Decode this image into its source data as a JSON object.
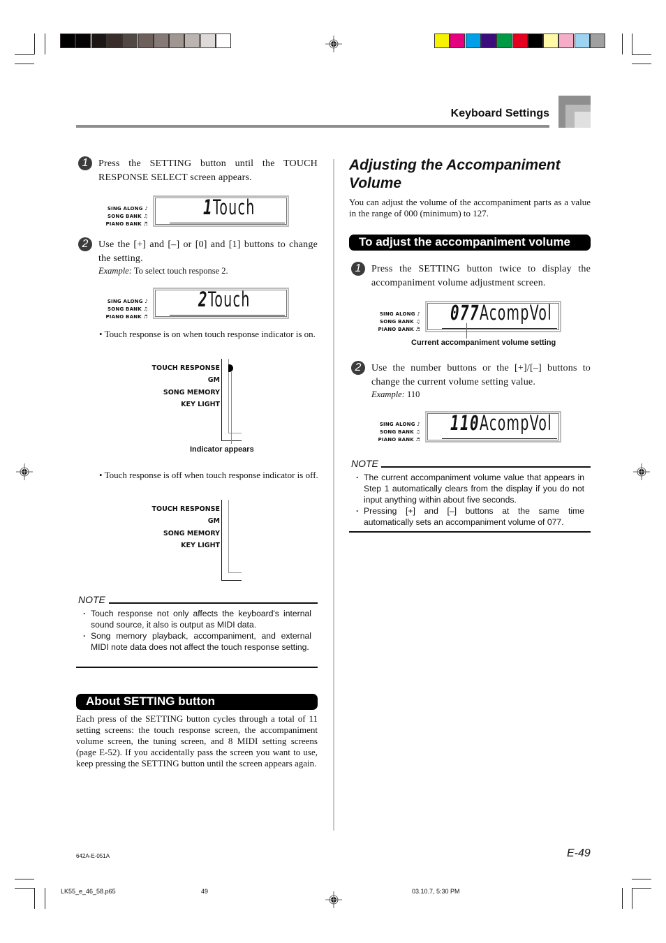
{
  "print_marks": {
    "grayscale_swatches": [
      "#000000",
      "#050303",
      "#1c1714",
      "#382d29",
      "#524843",
      "#6d605b",
      "#857a75",
      "#a19792",
      "#bcb4b0",
      "#dedad8",
      "#ffffff"
    ],
    "color_swatches": [
      "#f7f200",
      "#e4007f",
      "#00a0e9",
      "#3c0b7c",
      "#009944",
      "#e30020",
      "#000000",
      "#fff9a8",
      "#f6aec8",
      "#9cd4f2",
      "#a0a0a0"
    ]
  },
  "header": {
    "title": "Keyboard Settings"
  },
  "left": {
    "step1": {
      "number": "1",
      "text": "Press the SETTING button until the TOUCH RESPONSE SELECT screen appears.",
      "display": {
        "labels": [
          "SING ALONG",
          "SONG BANK",
          "PIANO BANK"
        ],
        "number": "1",
        "text": "Touch"
      }
    },
    "step2": {
      "number": "2",
      "text": "Use the [+] and [–] or [0] and [1] buttons to change the setting.",
      "example_label": "Example:",
      "example_text": "To select touch response 2.",
      "display": {
        "labels": [
          "SING ALONG",
          "SONG BANK",
          "PIANO BANK"
        ],
        "number": "2",
        "text": "Touch"
      }
    },
    "bullet_on": "• Touch response is on when touch response indicator is on.",
    "indicator_on": {
      "labels": [
        "TOUCH RESPONSE",
        "GM",
        "SONG MEMORY",
        "KEY LIGHT"
      ],
      "caption": "Indicator appears"
    },
    "bullet_off": "• Touch response is off when touch response indicator is off.",
    "indicator_off": {
      "labels": [
        "TOUCH RESPONSE",
        "GM",
        "SONG MEMORY",
        "KEY LIGHT"
      ]
    },
    "note": {
      "heading": "NOTE",
      "items": [
        "Touch response not only affects the keyboard's internal sound source, it also is output as MIDI data.",
        "Song memory playback, accompaniment, and external MIDI note data does not affect the touch response setting."
      ]
    },
    "about": {
      "heading": "About SETTING button",
      "text": "Each press of the SETTING button cycles through a total of 11 setting screens: the touch response screen, the accompaniment volume screen, the tuning screen, and 8 MIDI setting screens (page E-52). If you accidentally pass the screen you want to use, keep pressing the SETTING button until the screen appears again."
    }
  },
  "right": {
    "title": "Adjusting the Accompaniment Volume",
    "intro": "You can adjust the volume of the accompaniment parts as a value in the range of 000 (minimum) to 127.",
    "subheading": "To adjust the accompaniment volume",
    "step1": {
      "number": "1",
      "text": "Press the SETTING button twice to display the accompaniment volume adjustment screen.",
      "display": {
        "labels": [
          "SING ALONG",
          "SONG BANK",
          "PIANO BANK"
        ],
        "number": "077",
        "text": "AcompVol"
      },
      "caption": "Current accompaniment volume setting"
    },
    "step2": {
      "number": "2",
      "text": "Use the number buttons or the [+]/[–] buttons to change the current volume setting value.",
      "example_label": "Example:",
      "example_text": "110",
      "display": {
        "labels": [
          "SING ALONG",
          "SONG BANK",
          "PIANO BANK"
        ],
        "number": "110",
        "text": "AcompVol"
      }
    },
    "note": {
      "heading": "NOTE",
      "items": [
        "The current accompaniment volume value that appears in Step 1 automatically clears from the display if you do not input anything within about five seconds.",
        "Pressing [+] and [–] buttons at the same time automatically sets an accompaniment volume of 077."
      ]
    }
  },
  "footer": {
    "code": "642A-E-051A",
    "page_label": "E-49",
    "file": "LK55_e_46_58.p65",
    "page_number": "49",
    "timestamp": "03.10.7, 5:30 PM"
  }
}
